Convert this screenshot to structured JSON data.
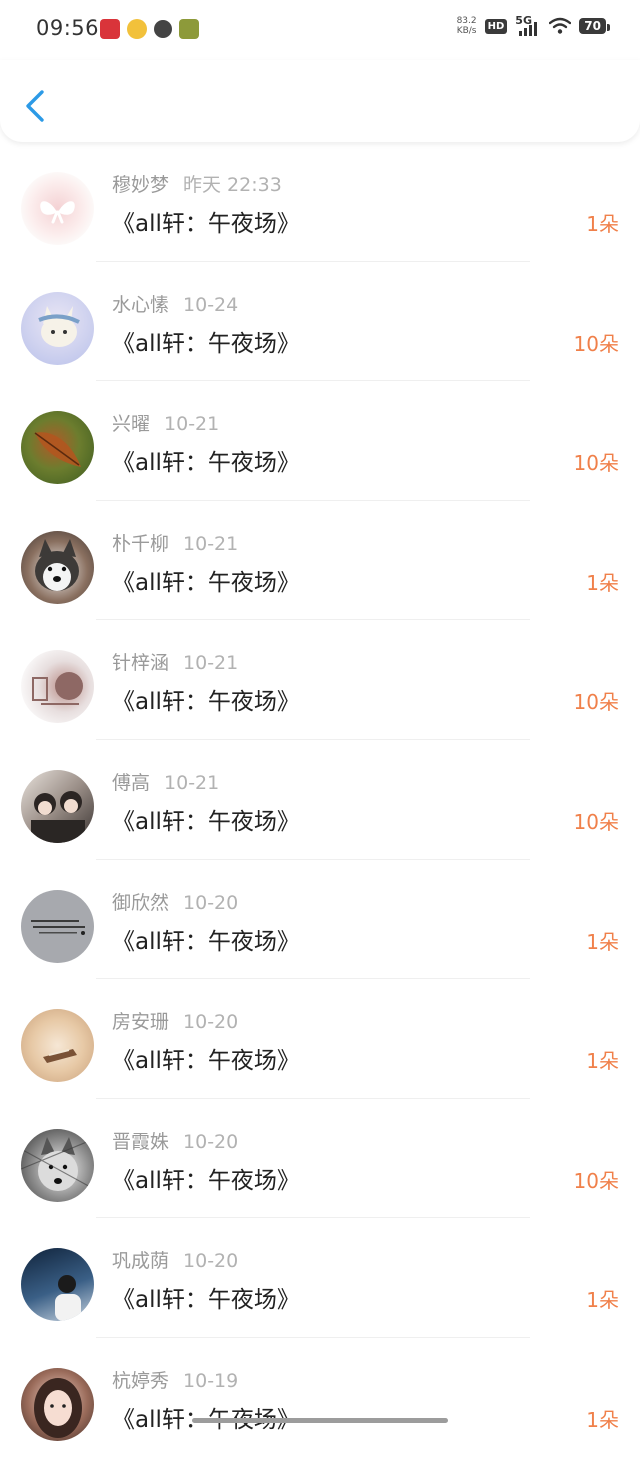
{
  "status_bar": {
    "time": "09:56",
    "net_speed_value": "83.2",
    "net_speed_unit": "KB/s",
    "hd_badge": "HD",
    "network": "5G",
    "battery": "70"
  },
  "header": {
    "back_icon": "chevron-left-icon"
  },
  "colors": {
    "accent": "#2c9ae6",
    "count_color": "#f0804a"
  },
  "list": {
    "items": [
      {
        "name": "穆妙梦",
        "date": "昨天 22:33",
        "title": "《all轩：午夜场》",
        "count": "1朵"
      },
      {
        "name": "水心愫",
        "date": "10-24",
        "title": "《all轩：午夜场》",
        "count": "10朵"
      },
      {
        "name": "兴曜",
        "date": "10-21",
        "title": "《all轩：午夜场》",
        "count": "10朵"
      },
      {
        "name": "朴千柳",
        "date": "10-21",
        "title": "《all轩：午夜场》",
        "count": "1朵"
      },
      {
        "name": "针梓涵",
        "date": "10-21",
        "title": "《all轩：午夜场》",
        "count": "10朵"
      },
      {
        "name": "傅高",
        "date": "10-21",
        "title": "《all轩：午夜场》",
        "count": "10朵"
      },
      {
        "name": "御欣然",
        "date": "10-20",
        "title": "《all轩：午夜场》",
        "count": "1朵"
      },
      {
        "name": "房安珊",
        "date": "10-20",
        "title": "《all轩：午夜场》",
        "count": "1朵"
      },
      {
        "name": "晋霞姝",
        "date": "10-20",
        "title": "《all轩：午夜场》",
        "count": "10朵"
      },
      {
        "name": "巩成荫",
        "date": "10-20",
        "title": "《all轩：午夜场》",
        "count": "1朵"
      },
      {
        "name": "杭婷秀",
        "date": "10-19",
        "title": "《all轩：午夜场》",
        "count": "1朵"
      }
    ]
  }
}
